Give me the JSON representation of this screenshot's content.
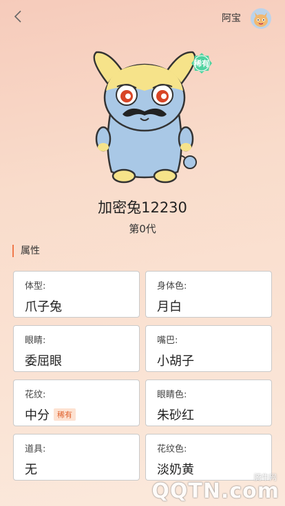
{
  "header": {
    "user_name": "阿宝"
  },
  "pet": {
    "rare_badge": "稀有",
    "name": "加密兔12230",
    "generation": "第0代"
  },
  "section": {
    "title": "属性"
  },
  "attributes": [
    {
      "key": "体型:",
      "value": "爪子兔",
      "tag": ""
    },
    {
      "key": "身体色:",
      "value": "月白",
      "tag": ""
    },
    {
      "key": "眼睛:",
      "value": "委屈眼",
      "tag": ""
    },
    {
      "key": "嘴巴:",
      "value": "小胡子",
      "tag": ""
    },
    {
      "key": "花纹:",
      "value": "中分",
      "tag": "稀有"
    },
    {
      "key": "眼睛色:",
      "value": "朱砂红",
      "tag": ""
    },
    {
      "key": "道具:",
      "value": "无",
      "tag": ""
    },
    {
      "key": "花纹色:",
      "value": "淡奶黄",
      "tag": ""
    }
  ],
  "watermark": {
    "brand": "QQTN.com",
    "sub": "腾牛网"
  },
  "colors": {
    "accent": "#f0784a",
    "body": "#a9c8e6",
    "head_pattern": "#f6e38a",
    "eye": "#d84526",
    "rare_badge_bg": "#4fd3a0"
  }
}
